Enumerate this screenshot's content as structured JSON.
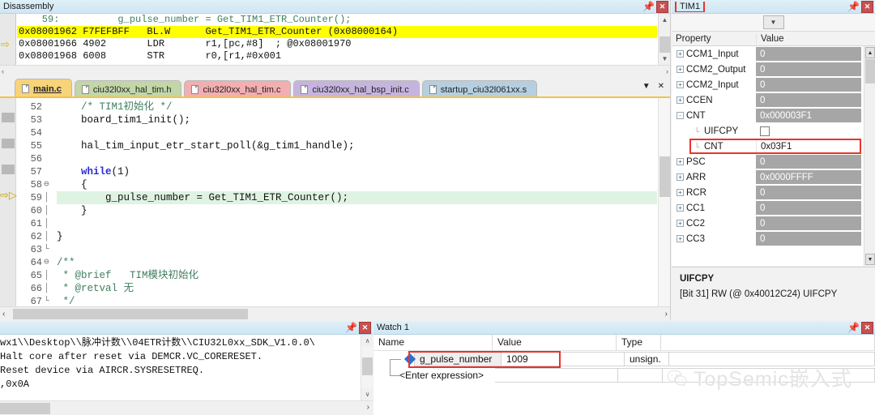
{
  "disassembly": {
    "title": "Disassembly",
    "pin_icon": "pin-icon",
    "close_icon": "close-icon",
    "lines": [
      {
        "kind": "source",
        "text": "    59:          g_pulse_number = Get_TIM1_ETR_Counter();"
      },
      {
        "kind": "code",
        "text": "0x08001962 F7FEFBFF   BL.W      Get_TIM1_ETR_Counter (0x08000164)",
        "highlight": true
      },
      {
        "kind": "code",
        "text": "0x08001966 4902       LDR       r1,[pc,#8]  ; @0x08001970",
        "pc": true
      },
      {
        "kind": "code",
        "text": "0x08001968 6008       STR       r0,[r1,#0x001"
      }
    ],
    "scroll_left_glyph": "‹",
    "scroll_right_glyph": "›"
  },
  "editor": {
    "tabs": [
      {
        "label": "main.c",
        "active": true,
        "color": "#f7d37a"
      },
      {
        "label": "ciu32l0xx_hal_tim.h",
        "active": false,
        "color": "#c2d6a8"
      },
      {
        "label": "ciu32l0xx_hal_tim.c",
        "active": false,
        "color": "#f2aeb0"
      },
      {
        "label": "ciu32l0xx_hal_bsp_init.c",
        "active": false,
        "color": "#c6b4df"
      },
      {
        "label": "startup_ciu32l061xx.s",
        "active": false,
        "color": "#b5cfe0"
      }
    ],
    "tab_menu_icon": "chevron-down-icon",
    "tab_close_icon": "close-icon",
    "current_line": 59,
    "code": [
      {
        "n": 52,
        "fold": "",
        "html": "    <span class='cmt'>/* TIM1初始化 */</span>"
      },
      {
        "n": 53,
        "fold": "",
        "html": "    board_tim1_init();"
      },
      {
        "n": 54,
        "fold": "",
        "html": ""
      },
      {
        "n": 55,
        "fold": "",
        "html": "    hal_tim_input_etr_start_poll(&g_tim1_handle);"
      },
      {
        "n": 56,
        "fold": "",
        "html": ""
      },
      {
        "n": 57,
        "fold": "",
        "html": "    <span class='kwb'>while</span>(1)"
      },
      {
        "n": 58,
        "fold": "⊖",
        "html": "    {"
      },
      {
        "n": 59,
        "fold": "│",
        "html": "        g_pulse_number = Get_TIM1_ETR_Counter();",
        "current": true
      },
      {
        "n": 60,
        "fold": "│",
        "html": "    }"
      },
      {
        "n": 61,
        "fold": "│",
        "html": ""
      },
      {
        "n": 62,
        "fold": "│",
        "html": "}"
      },
      {
        "n": 63,
        "fold": "└",
        "html": ""
      },
      {
        "n": 64,
        "fold": "⊖",
        "html": "<span class='cmt'>/**</span>"
      },
      {
        "n": 65,
        "fold": "│",
        "html": "<span class='cmt'> * @brief   TIM模块初始化</span>"
      },
      {
        "n": 66,
        "fold": "│",
        "html": "<span class='cmt'> * @retval 无</span>"
      },
      {
        "n": 67,
        "fold": "└",
        "html": "<span class='cmt'> */</span>"
      }
    ]
  },
  "tim1": {
    "title": "TIM1",
    "pin_icon": "pin-icon",
    "close_icon": "close-icon",
    "selector_icon": "chevron-down-icon",
    "columns": {
      "property": "Property",
      "value": "Value"
    },
    "rows": [
      {
        "name": "CCM1_Input",
        "value": "0",
        "expander": "+",
        "indent": 0,
        "value_style": "grey"
      },
      {
        "name": "CCM2_Output",
        "value": "0",
        "expander": "+",
        "indent": 0,
        "value_style": "grey"
      },
      {
        "name": "CCM2_Input",
        "value": "0",
        "expander": "+",
        "indent": 0,
        "value_style": "grey"
      },
      {
        "name": "CCEN",
        "value": "0",
        "expander": "+",
        "indent": 0,
        "value_style": "grey"
      },
      {
        "name": "CNT",
        "value": "0x000003F1",
        "expander": "-",
        "indent": 0,
        "value_style": "grey"
      },
      {
        "name": "UIFCPY",
        "value": "",
        "expander": "",
        "indent": 1,
        "value_style": "checkbox"
      },
      {
        "name": "CNT",
        "value": "0x03F1",
        "expander": "",
        "indent": 1,
        "value_style": "white",
        "highlight": true
      },
      {
        "name": "PSC",
        "value": "0",
        "expander": "+",
        "indent": 0,
        "value_style": "grey"
      },
      {
        "name": "ARR",
        "value": "0x0000FFFF",
        "expander": "+",
        "indent": 0,
        "value_style": "grey"
      },
      {
        "name": "RCR",
        "value": "0",
        "expander": "+",
        "indent": 0,
        "value_style": "grey"
      },
      {
        "name": "CC1",
        "value": "0",
        "expander": "+",
        "indent": 0,
        "value_style": "grey"
      },
      {
        "name": "CC2",
        "value": "0",
        "expander": "+",
        "indent": 0,
        "value_style": "grey"
      },
      {
        "name": "CC3",
        "value": "0",
        "expander": "+",
        "indent": 0,
        "value_style": "grey"
      }
    ],
    "description": {
      "title": "UIFCPY",
      "text": "[Bit 31] RW (@ 0x40012C24) UIFCPY"
    },
    "scroll_up_glyph": "▲",
    "scroll_down_glyph": "▼"
  },
  "console": {
    "title": "",
    "pin_icon": "pin-icon",
    "close_icon": "close-icon",
    "lines": [
      "wx1\\\\Desktop\\\\脉冲计数\\\\04ETR计数\\\\CIU32L0xx_SDK_V1.0.0\\",
      "Halt core after reset via DEMCR.VC_CORERESET.",
      "Reset device via AIRCR.SYSRESETREQ.",
      ",0x0A"
    ],
    "scroll_up_glyph": "∧",
    "scroll_down_glyph": "∨",
    "scroll_right_glyph": "›"
  },
  "watch": {
    "title": "Watch 1",
    "pin_icon": "pin-icon",
    "close_icon": "close-icon",
    "columns": [
      "Name",
      "Value",
      "Type",
      ""
    ],
    "rows": [
      {
        "name": "g_pulse_number",
        "value": "1009",
        "type": "unsign.",
        "icon": "watch-variable-icon",
        "highlight": true
      },
      {
        "name": "<Enter expression>",
        "value": "",
        "type": "",
        "icon": "",
        "highlight": false
      }
    ]
  },
  "watermark": {
    "text": "TopSemic嵌入式",
    "logo_icon": "wechat-logo-icon"
  },
  "colors": {
    "highlight_yellow": "#ffff00",
    "current_line_green": "#dff3e3",
    "annotation_red": "#e8342b",
    "title_blue": "#cfe6f4",
    "value_grey": "#a6a6a6"
  }
}
